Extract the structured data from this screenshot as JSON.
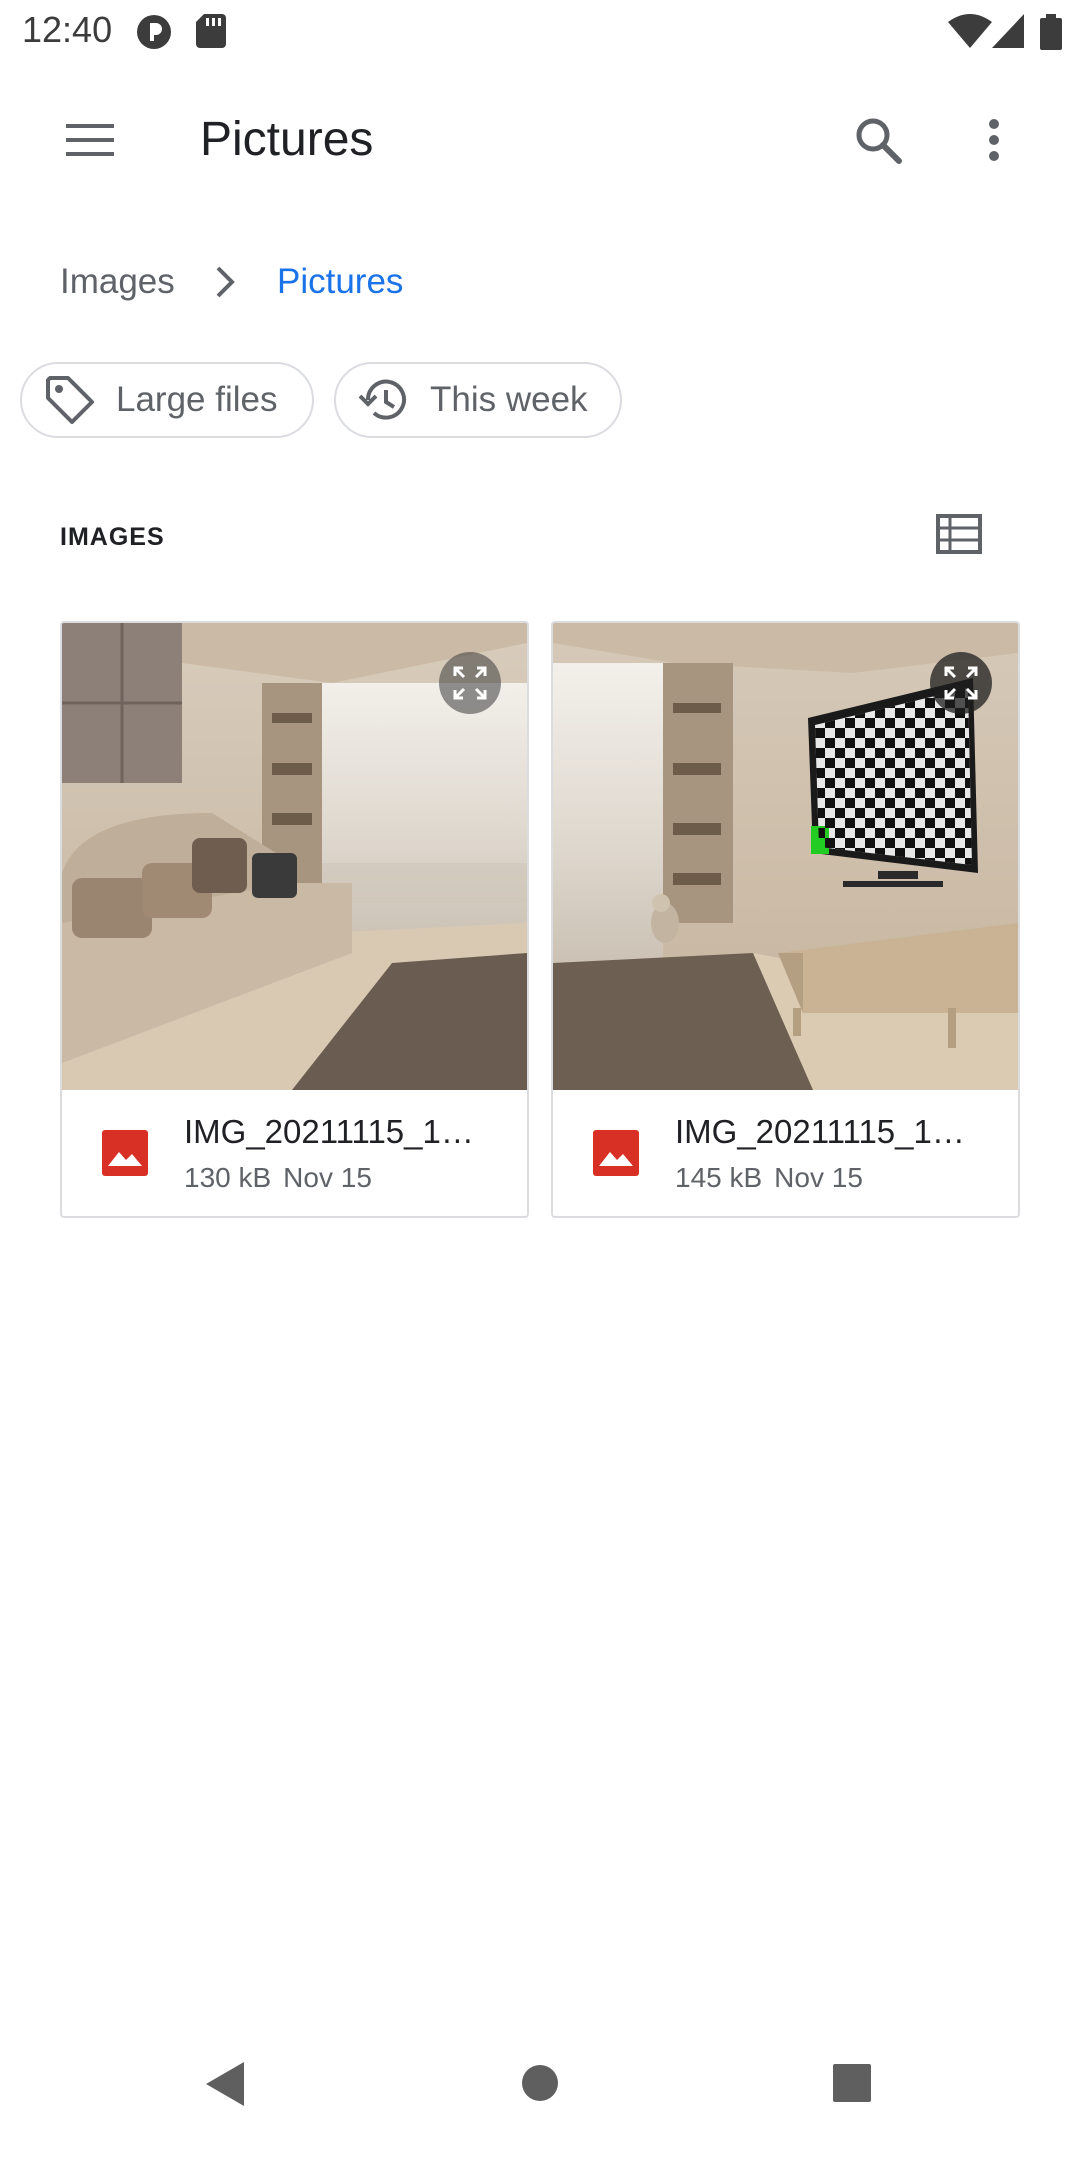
{
  "status_bar": {
    "time": "12:40"
  },
  "toolbar": {
    "title": "Pictures"
  },
  "breadcrumb": {
    "parent": "Images",
    "separator": ">",
    "current": "Pictures"
  },
  "chips": [
    {
      "label": "Large files",
      "icon": "label-icon"
    },
    {
      "label": "This week",
      "icon": "history-icon"
    }
  ],
  "section": {
    "title": "IMAGES"
  },
  "files": [
    {
      "name": "IMG_20211115_1…",
      "size": "130 kB",
      "date": "Nov 15",
      "thumbnail": "living room with sofa"
    },
    {
      "name": "IMG_20211115_1…",
      "size": "145 kB",
      "date": "Nov 15",
      "thumbnail": "living room with tv and cat"
    }
  ],
  "colors": {
    "accent": "#1a73e8",
    "image_file_icon": "#d93025",
    "chip_border": "#dadce0",
    "secondary_text": "#5f6368"
  }
}
